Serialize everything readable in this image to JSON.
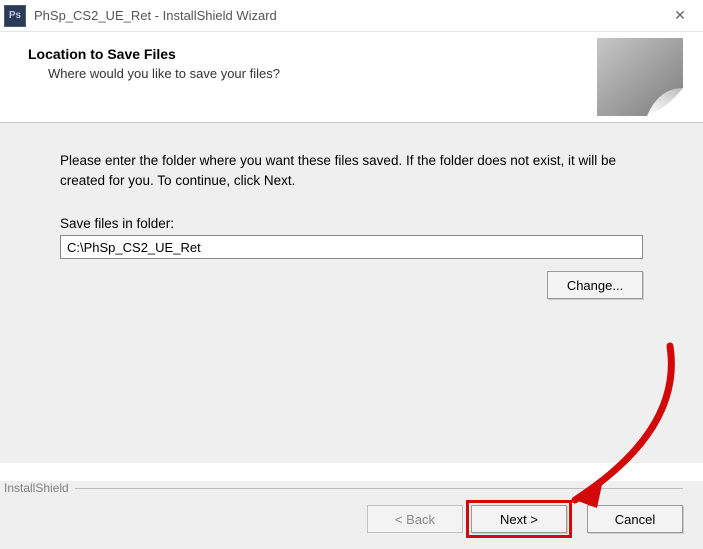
{
  "titlebar": {
    "title": "PhSp_CS2_UE_Ret - InstallShield Wizard"
  },
  "header": {
    "heading": "Location to Save Files",
    "subheading": "Where would you like to save your files?"
  },
  "content": {
    "instruction": "Please enter the folder where you want these files saved.  If the folder does not exist, it will be created for you.   To continue, click Next.",
    "field_label": "Save files in folder:",
    "folder_value": "C:\\PhSp_CS2_UE_Ret",
    "change_label": "Change..."
  },
  "footer": {
    "brand": "InstallShield",
    "back_label": "< Back",
    "next_label": "Next >",
    "cancel_label": "Cancel"
  }
}
